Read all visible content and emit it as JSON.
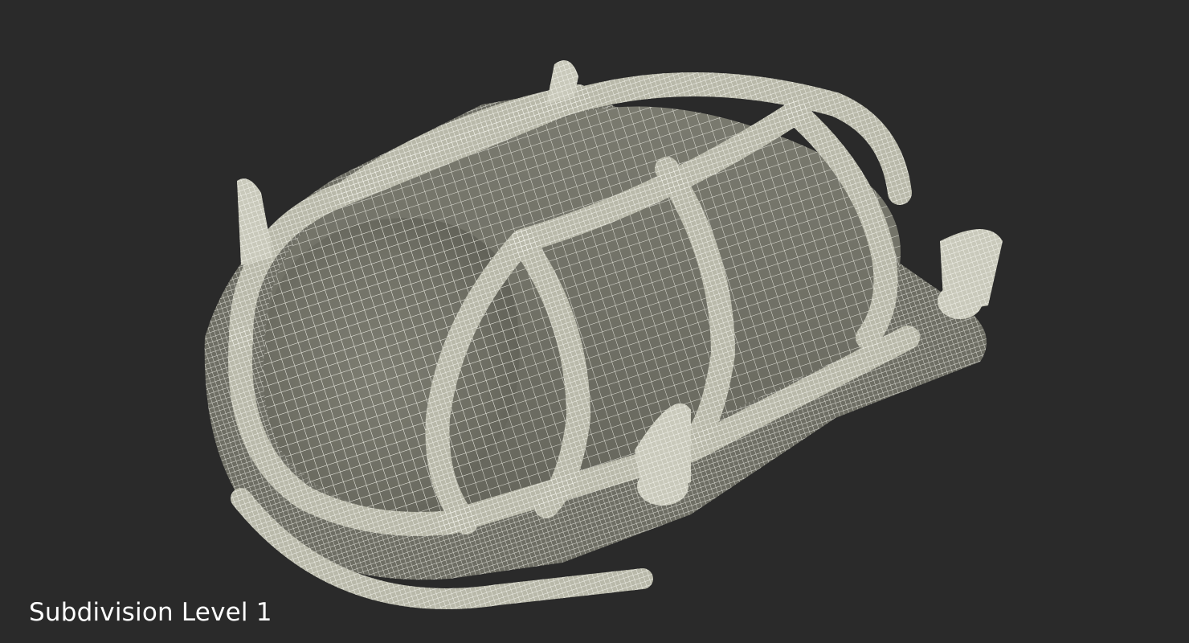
{
  "scene": {
    "caption": "Subdivision Level 1",
    "subject_icon": "bulkhead-cage-lamp-wireframe",
    "colors": {
      "background": "#2a2a2a",
      "surface": "#7d7d70",
      "wire": "#efefe6",
      "cage": "#b9b9aa",
      "caption_text": "#ffffff"
    }
  }
}
